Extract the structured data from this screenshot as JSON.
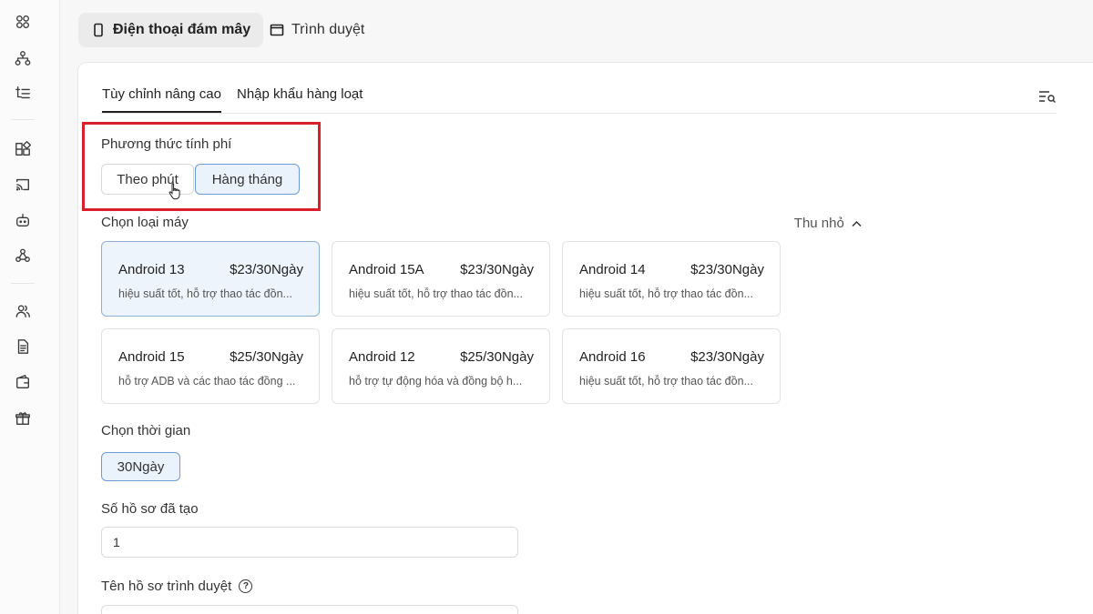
{
  "sidebar": {
    "icons": [
      {
        "name": "apps-grid-icon"
      },
      {
        "name": "org-chart-icon"
      },
      {
        "name": "tree-list-icon"
      },
      {
        "name": "widgets-icon"
      },
      {
        "name": "cast-icon"
      },
      {
        "name": "robot-icon"
      },
      {
        "name": "webhook-icon"
      },
      {
        "name": "users-icon"
      },
      {
        "name": "document-icon"
      },
      {
        "name": "wallet-icon"
      },
      {
        "name": "gift-icon"
      }
    ]
  },
  "top_tabs": {
    "cloud_phone": "Điện thoại đám mây",
    "browser": "Trình duyệt"
  },
  "sub_tabs": {
    "advanced": "Tùy chỉnh nâng cao",
    "bulk_import": "Nhập khẩu hàng loạt"
  },
  "billing": {
    "label": "Phương thức tính phí",
    "per_minute": "Theo phút",
    "monthly": "Hàng tháng",
    "selected": "Hàng tháng"
  },
  "machine": {
    "label": "Chọn loại máy",
    "collapse": "Thu nhỏ",
    "cards": [
      {
        "name": "Android 13",
        "price": "$23/30Ngày",
        "desc": "hiệu suất tốt, hỗ trợ thao tác đồn...",
        "selected": true
      },
      {
        "name": "Android 15A",
        "price": "$23/30Ngày",
        "desc": "hiệu suất tốt, hỗ trợ thao tác đồn...",
        "selected": false
      },
      {
        "name": "Android 14",
        "price": "$23/30Ngày",
        "desc": "hiệu suất tốt, hỗ trợ thao tác đồn...",
        "selected": false
      },
      {
        "name": "Android 15",
        "price": "$25/30Ngày",
        "desc": "hỗ trợ ADB và các thao tác đồng ...",
        "selected": false
      },
      {
        "name": "Android 12",
        "price": "$25/30Ngày",
        "desc": "hỗ trợ tự động hóa và đồng bộ h...",
        "selected": false
      },
      {
        "name": "Android 16",
        "price": "$23/30Ngày",
        "desc": "hiệu suất tốt, hỗ trợ thao tác đồn...",
        "selected": false
      }
    ]
  },
  "duration": {
    "label": "Chọn thời gian",
    "option": "30Ngày"
  },
  "profiles": {
    "label": "Số hồ sơ đã tạo",
    "value": "1"
  },
  "profile_name": {
    "label": "Tên hồ sơ trình duyệt",
    "help": "?"
  },
  "colors": {
    "highlight": "#d9202a",
    "selected_bg": "#eaf3fc",
    "selected_border": "#6f9bd6"
  }
}
